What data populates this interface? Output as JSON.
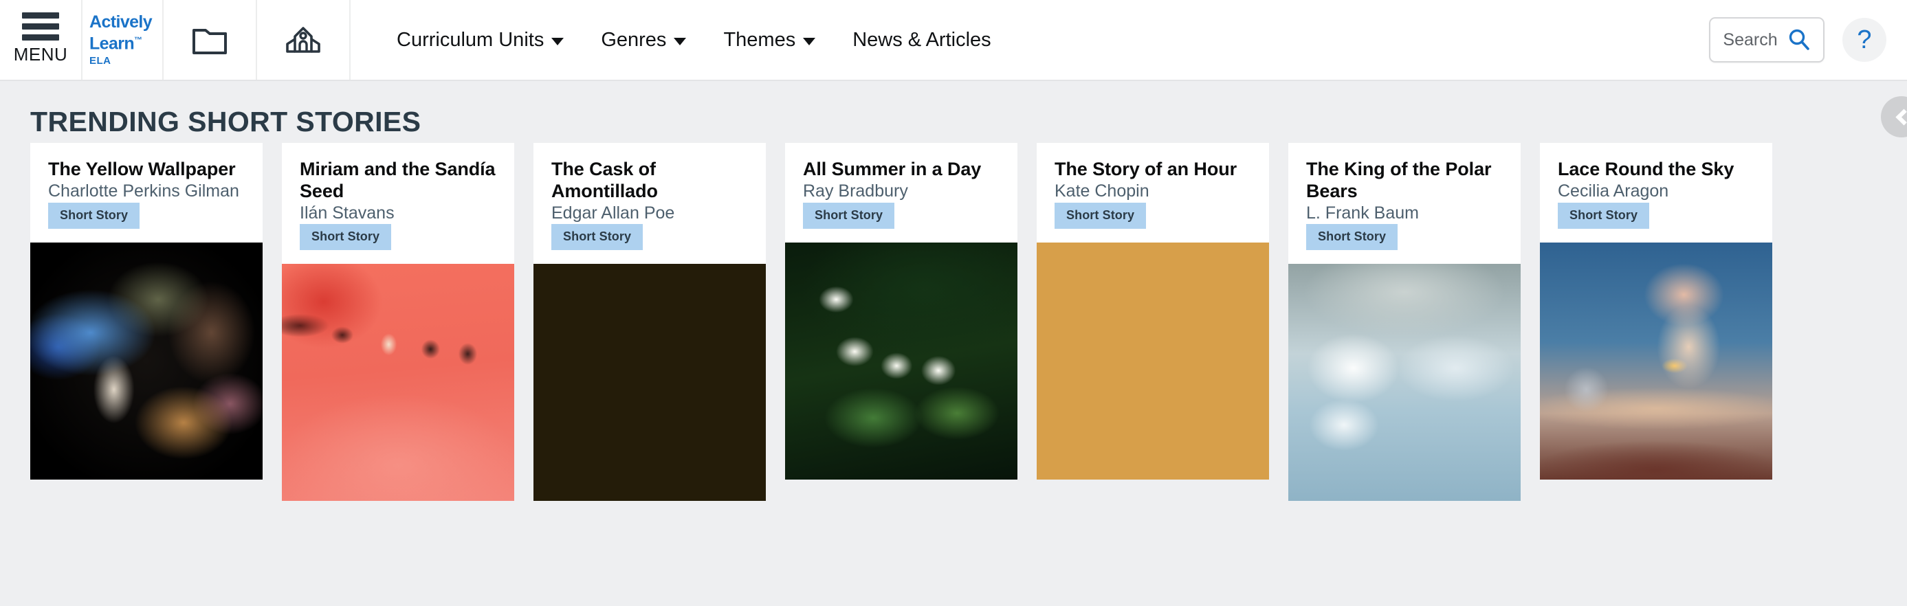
{
  "header": {
    "menu_label": "MENU",
    "logo": {
      "line1": "Actively",
      "line2": "Learn",
      "tm": "™",
      "subject": "ELA"
    },
    "icons": {
      "folder": "folder-icon",
      "school": "school-icon",
      "search": "search-icon",
      "help": "?"
    },
    "nav": [
      {
        "label": "Curriculum Units",
        "has_dropdown": true
      },
      {
        "label": "Genres",
        "has_dropdown": true
      },
      {
        "label": "Themes",
        "has_dropdown": true
      },
      {
        "label": "News & Articles",
        "has_dropdown": false
      }
    ],
    "search": {
      "placeholder": "Search",
      "value": "Search"
    }
  },
  "section": {
    "title": "TRENDING SHORT STORIES",
    "prev_label": "‹"
  },
  "cards": [
    {
      "title": "The Yellow Wallpaper",
      "author": "Charlotte Perkins Gilman",
      "badge": "Short Story",
      "art": "img-wallpaper"
    },
    {
      "title": "Miriam and the Sandía Seed",
      "author": "Ilán Stavans",
      "badge": "Short Story",
      "art": "img-watermelon"
    },
    {
      "title": "The Cask of Amontillado",
      "author": "Edgar Allan Poe",
      "badge": "Short Story",
      "art": "img-barrels"
    },
    {
      "title": "All Summer in a Day",
      "author": "Ray Bradbury",
      "badge": "Short Story",
      "art": "img-jasmine"
    },
    {
      "title": "The Story of an Hour",
      "author": "Kate Chopin",
      "badge": "Short Story",
      "art": "img-sunset"
    },
    {
      "title": "The King of the Polar Bears",
      "author": "L. Frank Baum",
      "badge": "Short Story",
      "art": "img-polarbear"
    },
    {
      "title": "Lace Round the Sky",
      "author": "Cecilia Aragon",
      "badge": "Short Story",
      "art": "img-observatory"
    }
  ],
  "colors": {
    "brand_blue": "#1a73c8",
    "page_bg": "#eeeff1",
    "badge_bg": "#aed1ef",
    "title_dark": "#2b3b47",
    "author_gray": "#4d5f6d"
  }
}
